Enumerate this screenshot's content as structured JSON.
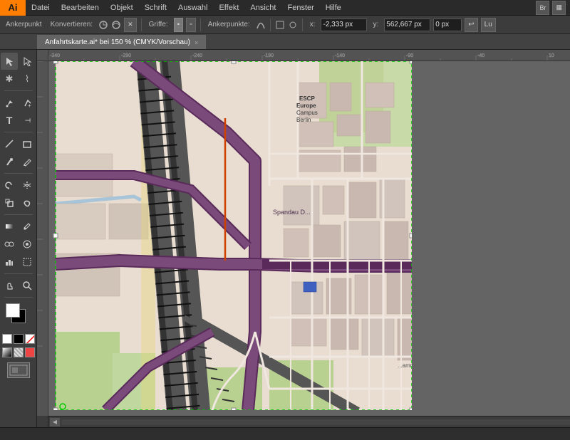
{
  "app": {
    "logo": "Ai",
    "logo_bg": "#ff7d00"
  },
  "menubar": {
    "items": [
      "Datei",
      "Bearbeiten",
      "Objekt",
      "Schrift",
      "Auswahl",
      "Effekt",
      "Ansicht",
      "Fenster",
      "Hilfe"
    ]
  },
  "toolbar": {
    "label_ankerpunkt": "Ankerpunkt",
    "label_konvertieren": "Konvertieren:",
    "label_griffe": "Griffe:",
    "label_ankerpunkte": "Ankerpunkte:",
    "x_label": "x:",
    "x_value": "-2.333 px",
    "y_label": "y:",
    "y_value": "562,667 px",
    "z_value": "0 px"
  },
  "tab": {
    "title": "Anfahrtskarte.ai* bei 150 % (CMYK/Vorschau)",
    "close": "×"
  },
  "tools": [
    {
      "name": "select",
      "icon": "↖",
      "active": true
    },
    {
      "name": "direct-select",
      "icon": "↗"
    },
    {
      "name": "magic-wand",
      "icon": "✱"
    },
    {
      "name": "lasso",
      "icon": "⌇"
    },
    {
      "name": "pen",
      "icon": "✒"
    },
    {
      "name": "add-anchor",
      "icon": "+"
    },
    {
      "name": "delete-anchor",
      "icon": "-"
    },
    {
      "name": "type",
      "icon": "T"
    },
    {
      "name": "line",
      "icon": "\\"
    },
    {
      "name": "rect",
      "icon": "□"
    },
    {
      "name": "brush",
      "icon": "✏"
    },
    {
      "name": "pencil",
      "icon": "✐"
    },
    {
      "name": "eraser",
      "icon": "◻"
    },
    {
      "name": "rotate",
      "icon": "↻"
    },
    {
      "name": "reflect",
      "icon": "⇔"
    },
    {
      "name": "scale",
      "icon": "⤢"
    },
    {
      "name": "warp",
      "icon": "⌗"
    },
    {
      "name": "gradient",
      "icon": "▣"
    },
    {
      "name": "eyedropper",
      "icon": "⊘"
    },
    {
      "name": "blend",
      "icon": "∞"
    },
    {
      "name": "symbol",
      "icon": "⊛"
    },
    {
      "name": "column-graph",
      "icon": "▦"
    },
    {
      "name": "artboard",
      "icon": "⊞"
    },
    {
      "name": "slice",
      "icon": "⊟"
    },
    {
      "name": "hand",
      "icon": "✋"
    },
    {
      "name": "zoom",
      "icon": "⊕"
    }
  ],
  "statusbar": {
    "text": ""
  }
}
